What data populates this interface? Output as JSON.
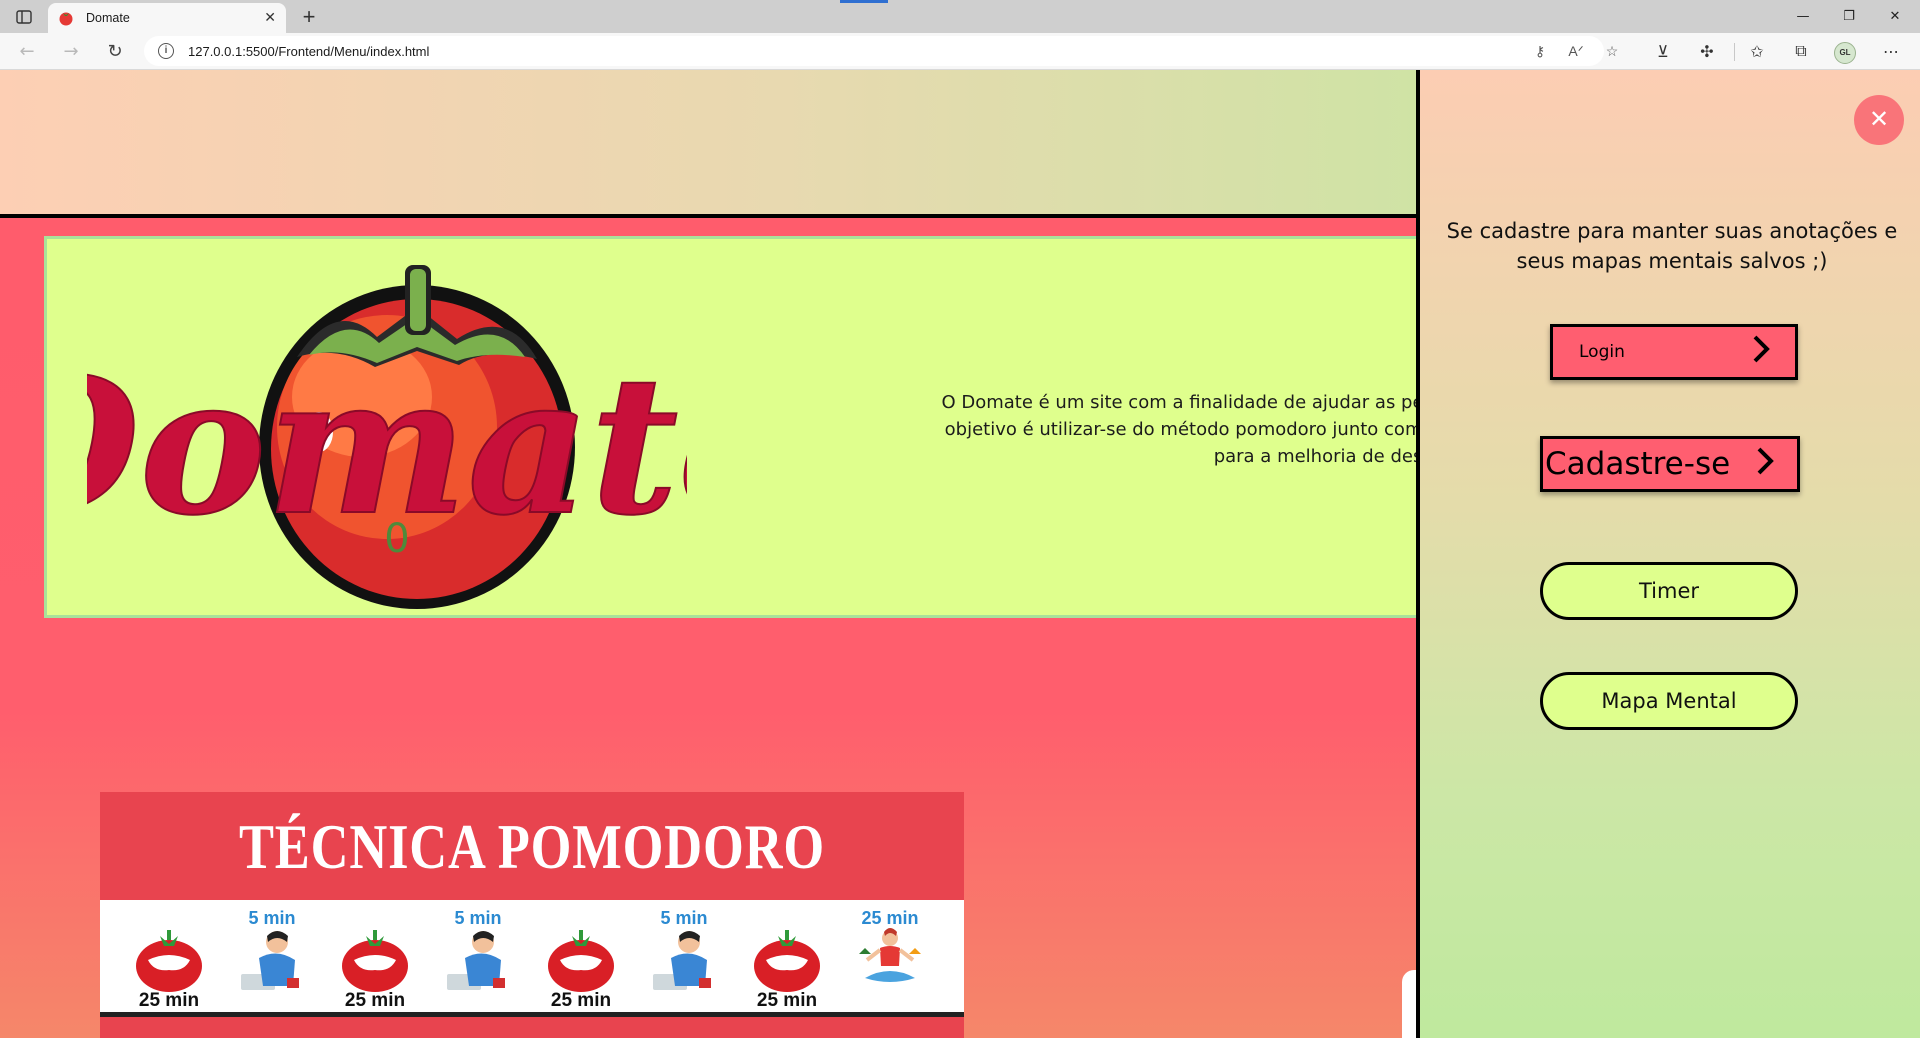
{
  "browser": {
    "tab_title": "Domate",
    "new_tab_label": "+",
    "url": "127.0.0.1:5500/Frontend/Menu/index.html",
    "profile_initials": "GL",
    "icons": [
      "sidebar-toggle-icon",
      "back-icon",
      "forward-icon",
      "refresh-icon",
      "info-icon",
      "key-icon",
      "read-aloud-icon",
      "add-favorite-icon",
      "extension-icon",
      "extensions-icon",
      "favorites-icon",
      "collections-icon",
      "more-icon"
    ]
  },
  "hero": {
    "logo_text": "Domate",
    "description_lines": [
      "O Domate é um site com a finalidade de ajudar as pessoas a se concentra",
      "objetivo é utilizar-se do método pomodoro junto com o mapa mental. E ai",
      "para a melhoria de desempenh"
    ]
  },
  "pomodoro": {
    "title": "TÉCNICA POMODORO",
    "sequence": [
      {
        "top": "",
        "bottom": "25 min",
        "kind": "tomato"
      },
      {
        "top": "5 min",
        "bottom": "",
        "kind": "person"
      },
      {
        "top": "",
        "bottom": "25 min",
        "kind": "tomato"
      },
      {
        "top": "5 min",
        "bottom": "",
        "kind": "person"
      },
      {
        "top": "",
        "bottom": "25 min",
        "kind": "tomato"
      },
      {
        "top": "5 min",
        "bottom": "",
        "kind": "person"
      },
      {
        "top": "",
        "bottom": "25 min",
        "kind": "tomato"
      },
      {
        "top": "25 min",
        "bottom": "",
        "kind": "yoga"
      }
    ]
  },
  "side_panel": {
    "close_label": "✕",
    "message": "Se cadastre para manter suas anotações e seus mapas mentais salvos ;)",
    "login_label": "Login",
    "signup_label": "Cadastre-se",
    "timer_label": "Timer",
    "mind_map_label": "Mapa Mental"
  },
  "colors": {
    "header_gradient_start": "#fdcfb4",
    "header_gradient_end": "#cfe3a5",
    "main_bg": "#ff5c6c",
    "hero_bg": "#dfff8d",
    "button_red": "#ff5e70",
    "button_green": "#dfff8d",
    "close_button": "#f97479",
    "pomodoro_red": "#e8444f",
    "logo_red": "#c8103a"
  }
}
